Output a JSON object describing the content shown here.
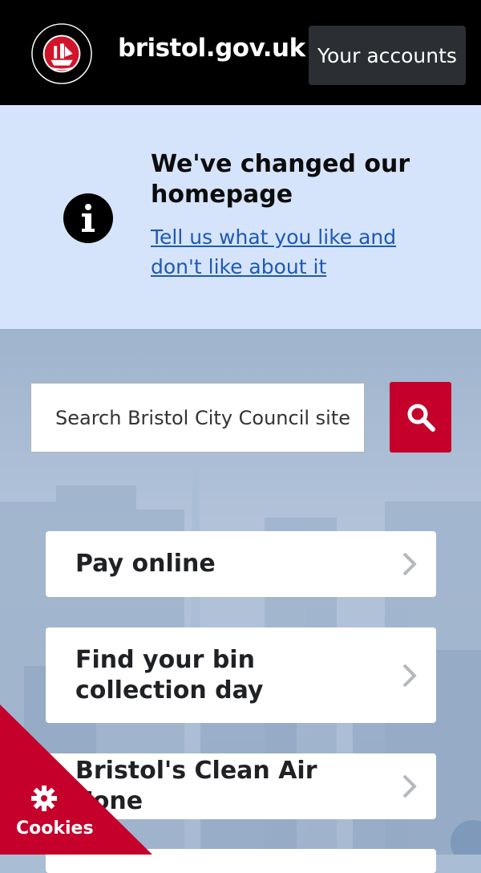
{
  "header": {
    "site_name": "bristol.gov.uk",
    "accounts_label": "Your accounts",
    "logo_icon": "bristol-city-council-crest"
  },
  "notice": {
    "title": "We've changed our homepage",
    "link_text": "Tell us what you like and don't like about it",
    "icon": "info-icon"
  },
  "search": {
    "placeholder": "Search Bristol City Council site",
    "button_icon": "search-icon"
  },
  "quick_links": [
    {
      "label": "Pay online"
    },
    {
      "label": "Find your bin collection day"
    },
    {
      "label": "Bristol's Clean Air Zone"
    }
  ],
  "cookies": {
    "label": "Cookies",
    "icon": "gear-icon"
  },
  "colors": {
    "header_bg": "#000000",
    "notice_bg": "#d6e4fb",
    "brand_red": "#c4002b",
    "link_blue": "#1d59b5"
  }
}
